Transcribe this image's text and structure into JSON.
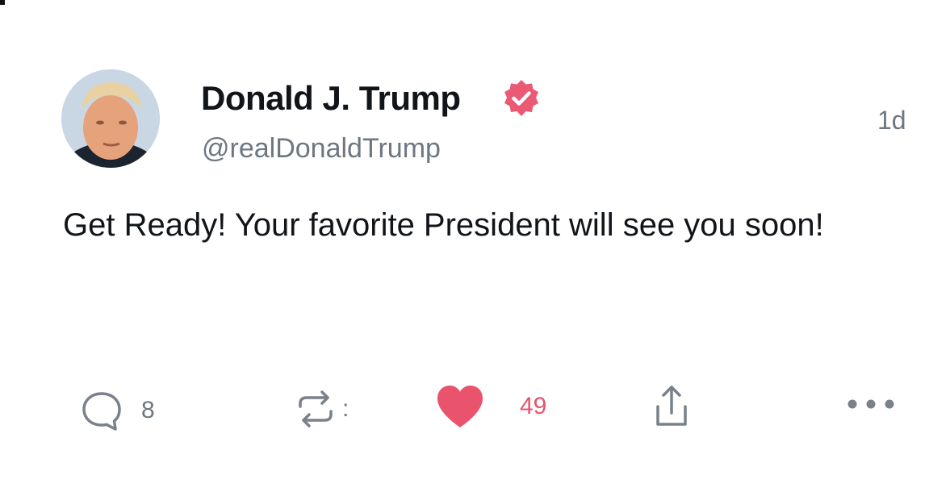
{
  "post": {
    "author": {
      "display_name": "Donald J. Trump",
      "handle": "@realDonaldTrump",
      "verified": true,
      "verified_color": "#ea5a74"
    },
    "timestamp": "1d",
    "text": "Get Ready! Your favorite President will see you soon!",
    "actions": {
      "reply": {
        "icon": "reply-icon",
        "count": "8"
      },
      "repost": {
        "icon": "repost-icon",
        "count": ":"
      },
      "like": {
        "icon": "heart-icon",
        "count": "49",
        "liked": true,
        "color": "#e9536c"
      },
      "share": {
        "icon": "share-icon"
      },
      "more": {
        "icon": "more-icon"
      }
    }
  },
  "colors": {
    "text_primary": "#111418",
    "text_secondary": "#6e7680",
    "accent": "#e9536c"
  }
}
